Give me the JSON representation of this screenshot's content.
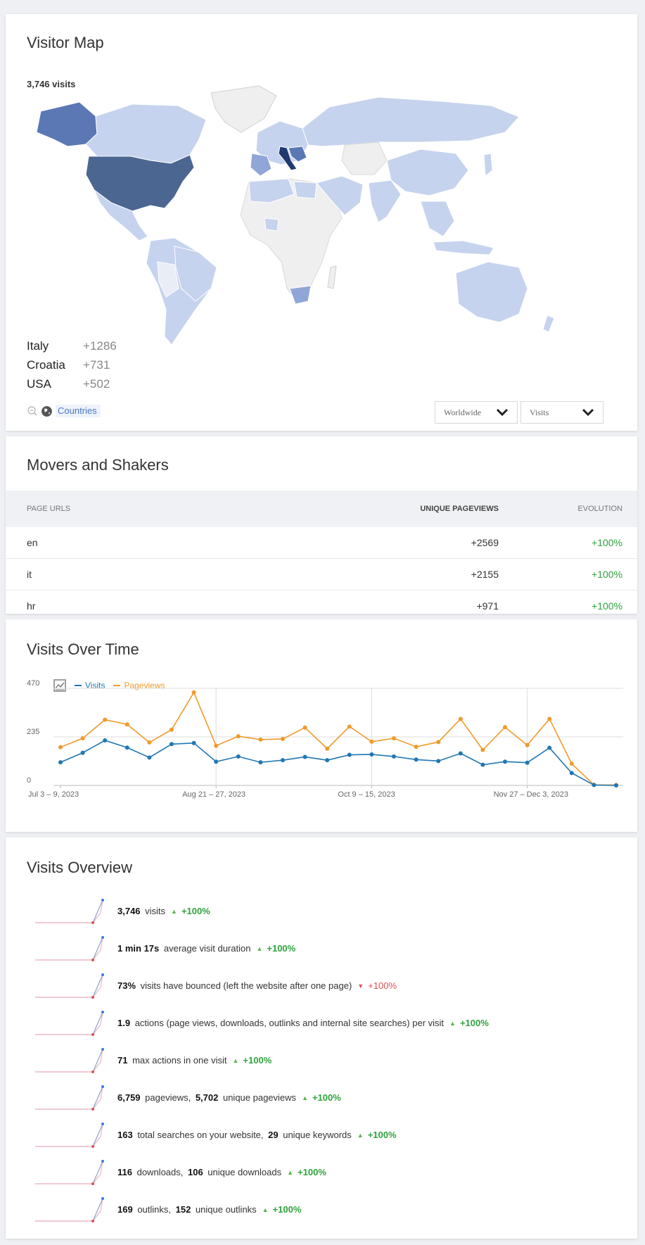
{
  "map": {
    "title": "Visitor Map",
    "visits_total": "3,746 visits",
    "top_countries": [
      {
        "name": "Italy",
        "value": "+1286"
      },
      {
        "name": "Croatia",
        "value": "+731"
      },
      {
        "name": "USA",
        "value": "+502"
      }
    ],
    "countries_link": "Countries",
    "region_select": "Worldwide",
    "metric_select": "Visits",
    "colors": {
      "highest": "#2d4b7f",
      "high": "#5b78b5",
      "mid": "#8fa6d6",
      "low": "#c6d3ee",
      "none": "#efefef"
    }
  },
  "movers": {
    "title": "Movers and Shakers",
    "columns": [
      "PAGE URLS",
      "UNIQUE PAGEVIEWS",
      "EVOLUTION"
    ],
    "rows": [
      {
        "page": "en",
        "unique": "+2569",
        "evolution": "+100%"
      },
      {
        "page": "it",
        "unique": "+2155",
        "evolution": "+100%"
      },
      {
        "page": "hr",
        "unique": "+971",
        "evolution": "+100%"
      }
    ]
  },
  "visits_over_time": {
    "title": "Visits Over Time",
    "legend": [
      "Visits",
      "Pageviews"
    ],
    "colors": {
      "visits": "#1f77b4",
      "pageviews": "#f09a2a"
    }
  },
  "chart_data": {
    "type": "line",
    "x_tick_labels": [
      "Jul 3 – 9, 2023",
      "Aug 21 – 27, 2023",
      "Oct 9 – 15, 2023",
      "Nov 27 – Dec 3, 2023"
    ],
    "y_tick_labels": [
      "0",
      "235",
      "470"
    ],
    "ylim": [
      0,
      470
    ],
    "series": [
      {
        "name": "Visits",
        "values": [
          112,
          158,
          218,
          183,
          135,
          200,
          205,
          115,
          140,
          112,
          122,
          138,
          122,
          148,
          150,
          140,
          125,
          118,
          155,
          100,
          115,
          110,
          182,
          60,
          2,
          0
        ]
      },
      {
        "name": "Pageviews",
        "values": [
          185,
          228,
          318,
          295,
          208,
          270,
          450,
          192,
          238,
          222,
          225,
          280,
          178,
          285,
          212,
          228,
          187,
          210,
          322,
          172,
          282,
          195,
          322,
          105,
          3,
          2
        ]
      }
    ]
  },
  "overview": {
    "title": "Visits Overview",
    "items": [
      {
        "parts": [
          {
            "b": "3,746"
          },
          {
            "t": " visits"
          }
        ],
        "trend": "up",
        "change": "+100%"
      },
      {
        "parts": [
          {
            "b": "1 min 17s"
          },
          {
            "t": " average visit duration"
          }
        ],
        "trend": "up",
        "change": "+100%"
      },
      {
        "parts": [
          {
            "b": "73%"
          },
          {
            "t": " visits have bounced (left the website after one page)"
          }
        ],
        "trend": "down",
        "change": "+100%"
      },
      {
        "parts": [
          {
            "b": "1.9"
          },
          {
            "t": " actions (page views, downloads, outlinks and internal site searches) per visit"
          }
        ],
        "trend": "up",
        "change": "+100%"
      },
      {
        "parts": [
          {
            "b": "71"
          },
          {
            "t": " max actions in one visit"
          }
        ],
        "trend": "up",
        "change": "+100%"
      },
      {
        "parts": [
          {
            "b": "6,759"
          },
          {
            "t": " pageviews, "
          },
          {
            "b": "5,702"
          },
          {
            "t": " unique pageviews"
          }
        ],
        "trend": "up",
        "change": "+100%"
      },
      {
        "parts": [
          {
            "b": "163"
          },
          {
            "t": " total searches on your website, "
          },
          {
            "b": "29"
          },
          {
            "t": " unique keywords"
          }
        ],
        "trend": "up",
        "change": "+100%"
      },
      {
        "parts": [
          {
            "b": "116"
          },
          {
            "t": " downloads, "
          },
          {
            "b": "106"
          },
          {
            "t": " unique downloads"
          }
        ],
        "trend": "up",
        "change": "+100%"
      },
      {
        "parts": [
          {
            "b": "169"
          },
          {
            "t": " outlinks, "
          },
          {
            "b": "152"
          },
          {
            "t": " unique outlinks"
          }
        ],
        "trend": "up",
        "change": "+100%"
      }
    ]
  }
}
